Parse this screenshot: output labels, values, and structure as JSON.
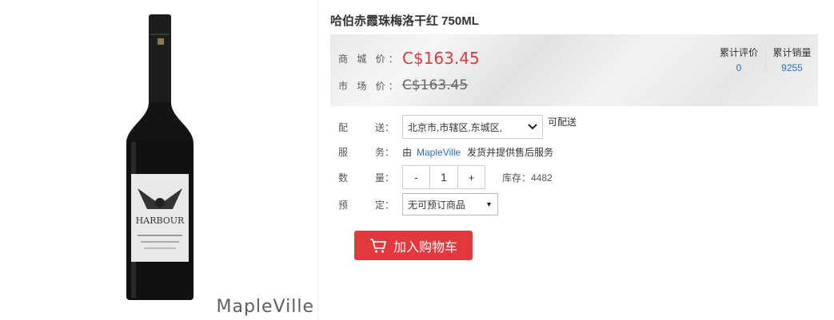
{
  "product": {
    "title": "哈伯赤霞珠梅洛干红 750ML",
    "watermark": "MapleVille",
    "label_brand": "HARBOUR"
  },
  "price": {
    "shop_label": "商 城 价：",
    "shop_value": "C$163.45",
    "market_label": "市 场 价：",
    "market_value": "C$163.45"
  },
  "stats": {
    "reviews_label": "累计评价",
    "reviews_value": "0",
    "sales_label": "累计销量",
    "sales_value": "9255"
  },
  "delivery": {
    "label_a": "配",
    "label_b": "送：",
    "region": "北京市,市辖区,东城区,",
    "note": "可配送"
  },
  "service": {
    "label_a": "服",
    "label_b": "务：",
    "prefix": "由",
    "seller": "MapleVille",
    "suffix": "发货并提供售后服务"
  },
  "quantity": {
    "label_a": "数",
    "label_b": "量：",
    "minus": "-",
    "value": "1",
    "plus": "+",
    "stock": "库存：4482"
  },
  "reserve": {
    "label_a": "预",
    "label_b": "定：",
    "selected": "无可预订商品"
  },
  "cart": {
    "label": "加入购物车"
  },
  "colors": {
    "accent": "#e4393c",
    "link": "#2a6ebb"
  }
}
